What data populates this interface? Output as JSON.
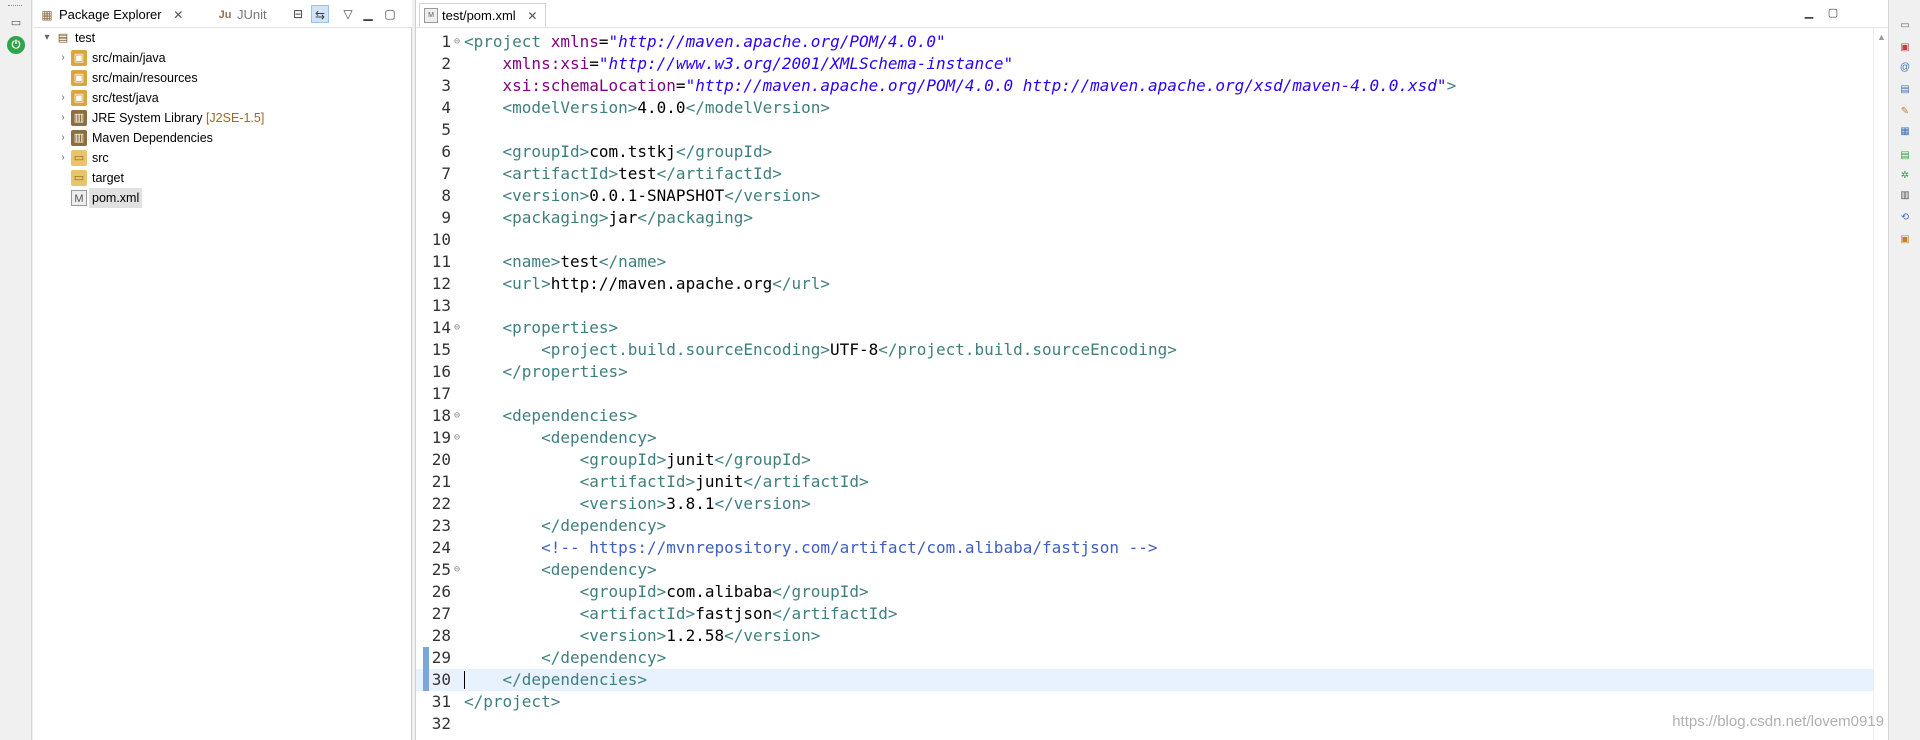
{
  "window": {
    "title": "test/pom.xml"
  },
  "views": {
    "package_explorer": {
      "label": "Package Explorer",
      "icon": "package-explorer-icon"
    },
    "junit": {
      "label": "JUnit",
      "icon": "junit-icon"
    }
  },
  "tree": [
    {
      "label": "test",
      "kind": "project",
      "expanded": true,
      "depth": 0
    },
    {
      "label": "src/main/java",
      "kind": "source-folder",
      "depth": 1,
      "twisty": true
    },
    {
      "label": "src/main/resources",
      "kind": "source-folder",
      "depth": 1,
      "twisty": false
    },
    {
      "label": "src/test/java",
      "kind": "source-folder",
      "depth": 1,
      "twisty": true
    },
    {
      "label": "JRE System Library",
      "decoration": "[J2SE-1.5]",
      "kind": "library",
      "depth": 1,
      "twisty": true
    },
    {
      "label": "Maven Dependencies",
      "kind": "library",
      "depth": 1,
      "twisty": true
    },
    {
      "label": "src",
      "kind": "folder",
      "depth": 1,
      "twisty": true
    },
    {
      "label": "target",
      "kind": "folder",
      "depth": 1,
      "twisty": false
    },
    {
      "label": "pom.xml",
      "kind": "xml-file",
      "depth": 1,
      "twisty": false,
      "selected": true
    }
  ],
  "editor": {
    "tab_label": "test/pom.xml",
    "current_line": 30,
    "lines": [
      {
        "n": "1",
        "fold": "⊖",
        "tokens": [
          [
            "tg",
            "<project "
          ],
          [
            "an",
            "xmlns"
          ],
          [
            "tx",
            "="
          ],
          [
            "av",
            "\"http://maven.apache.org/POM/4.0.0\""
          ]
        ]
      },
      {
        "n": "2",
        "tokens": [
          [
            "tx",
            "    "
          ],
          [
            "an",
            "xmlns:xsi"
          ],
          [
            "tx",
            "="
          ],
          [
            "av",
            "\"http://www.w3.org/2001/XMLSchema-instance\""
          ]
        ]
      },
      {
        "n": "3",
        "tokens": [
          [
            "tx",
            "    "
          ],
          [
            "an",
            "xsi:schemaLocation"
          ],
          [
            "tx",
            "="
          ],
          [
            "av",
            "\"http://maven.apache.org/POM/4.0.0 http://maven.apache.org/xsd/maven-4.0.0.xsd\""
          ],
          [
            "tg",
            ">"
          ]
        ]
      },
      {
        "n": "4",
        "tokens": [
          [
            "tx",
            "    "
          ],
          [
            "tg",
            "<modelVersion>"
          ],
          [
            "tx",
            "4.0.0"
          ],
          [
            "tg",
            "</modelVersion>"
          ]
        ]
      },
      {
        "n": "5",
        "tokens": []
      },
      {
        "n": "6",
        "tokens": [
          [
            "tx",
            "    "
          ],
          [
            "tg",
            "<groupId>"
          ],
          [
            "tx",
            "com.tstkj"
          ],
          [
            "tg",
            "</groupId>"
          ]
        ]
      },
      {
        "n": "7",
        "tokens": [
          [
            "tx",
            "    "
          ],
          [
            "tg",
            "<artifactId>"
          ],
          [
            "tx",
            "test"
          ],
          [
            "tg",
            "</artifactId>"
          ]
        ]
      },
      {
        "n": "8",
        "tokens": [
          [
            "tx",
            "    "
          ],
          [
            "tg",
            "<version>"
          ],
          [
            "tx",
            "0.0.1-SNAPSHOT"
          ],
          [
            "tg",
            "</version>"
          ]
        ]
      },
      {
        "n": "9",
        "tokens": [
          [
            "tx",
            "    "
          ],
          [
            "tg",
            "<packaging>"
          ],
          [
            "tx",
            "jar"
          ],
          [
            "tg",
            "</packaging>"
          ]
        ]
      },
      {
        "n": "10",
        "tokens": []
      },
      {
        "n": "11",
        "tokens": [
          [
            "tx",
            "    "
          ],
          [
            "tg",
            "<name>"
          ],
          [
            "tx",
            "test"
          ],
          [
            "tg",
            "</name>"
          ]
        ]
      },
      {
        "n": "12",
        "tokens": [
          [
            "tx",
            "    "
          ],
          [
            "tg",
            "<url>"
          ],
          [
            "tx",
            "http://maven.apache.org"
          ],
          [
            "tg",
            "</url>"
          ]
        ]
      },
      {
        "n": "13",
        "tokens": []
      },
      {
        "n": "14",
        "fold": "⊖",
        "tokens": [
          [
            "tx",
            "    "
          ],
          [
            "tg",
            "<properties>"
          ]
        ]
      },
      {
        "n": "15",
        "tokens": [
          [
            "tx",
            "        "
          ],
          [
            "tg",
            "<project.build.sourceEncoding>"
          ],
          [
            "tx",
            "UTF-8"
          ],
          [
            "tg",
            "</project.build.sourceEncoding>"
          ]
        ]
      },
      {
        "n": "16",
        "tokens": [
          [
            "tx",
            "    "
          ],
          [
            "tg",
            "</properties>"
          ]
        ]
      },
      {
        "n": "17",
        "tokens": []
      },
      {
        "n": "18",
        "fold": "⊖",
        "tokens": [
          [
            "tx",
            "    "
          ],
          [
            "tg",
            "<dependencies>"
          ]
        ]
      },
      {
        "n": "19",
        "fold": "⊖",
        "tokens": [
          [
            "tx",
            "        "
          ],
          [
            "tg",
            "<dependency>"
          ]
        ]
      },
      {
        "n": "20",
        "tokens": [
          [
            "tx",
            "            "
          ],
          [
            "tg",
            "<groupId>"
          ],
          [
            "tx",
            "junit"
          ],
          [
            "tg",
            "</groupId>"
          ]
        ]
      },
      {
        "n": "21",
        "tokens": [
          [
            "tx",
            "            "
          ],
          [
            "tg",
            "<artifactId>"
          ],
          [
            "tx",
            "junit"
          ],
          [
            "tg",
            "</artifactId>"
          ]
        ]
      },
      {
        "n": "22",
        "tokens": [
          [
            "tx",
            "            "
          ],
          [
            "tg",
            "<version>"
          ],
          [
            "tx",
            "3.8.1"
          ],
          [
            "tg",
            "</version>"
          ]
        ]
      },
      {
        "n": "23",
        "tokens": [
          [
            "tx",
            "        "
          ],
          [
            "tg",
            "</dependency>"
          ]
        ]
      },
      {
        "n": "24",
        "tokens": [
          [
            "tx",
            "        "
          ],
          [
            "cm",
            "<!-- https://mvnrepository.com/artifact/com.alibaba/fastjson -->"
          ]
        ]
      },
      {
        "n": "25",
        "fold": "⊖",
        "tokens": [
          [
            "tx",
            "        "
          ],
          [
            "tg",
            "<dependency>"
          ]
        ]
      },
      {
        "n": "26",
        "tokens": [
          [
            "tx",
            "            "
          ],
          [
            "tg",
            "<groupId>"
          ],
          [
            "tx",
            "com.alibaba"
          ],
          [
            "tg",
            "</groupId>"
          ]
        ]
      },
      {
        "n": "27",
        "tokens": [
          [
            "tx",
            "            "
          ],
          [
            "tg",
            "<artifactId>"
          ],
          [
            "tx",
            "fastjson"
          ],
          [
            "tg",
            "</artifactId>"
          ]
        ]
      },
      {
        "n": "28",
        "tokens": [
          [
            "tx",
            "            "
          ],
          [
            "tg",
            "<version>"
          ],
          [
            "tx",
            "1.2.58"
          ],
          [
            "tg",
            "</version>"
          ]
        ]
      },
      {
        "n": "29",
        "tokens": [
          [
            "tx",
            "        "
          ],
          [
            "tg",
            "</dependency>"
          ]
        ]
      },
      {
        "n": "30",
        "tokens": [
          [
            "tx",
            "    "
          ],
          [
            "tg",
            "</dependencies>"
          ]
        ]
      },
      {
        "n": "31",
        "tokens": [
          [
            "tg",
            "</project>"
          ]
        ]
      },
      {
        "n": "32",
        "tokens": []
      }
    ]
  },
  "watermark": "https://blog.csdn.net/lovem0919",
  "colors": {
    "tag": "#3f7f7f",
    "attr_name": "#7f007f",
    "attr_value": "#2a00ff",
    "comment": "#3f5fbf",
    "current_line_bg": "#e8f2fe",
    "selection_bg": "#cfe4f7"
  }
}
